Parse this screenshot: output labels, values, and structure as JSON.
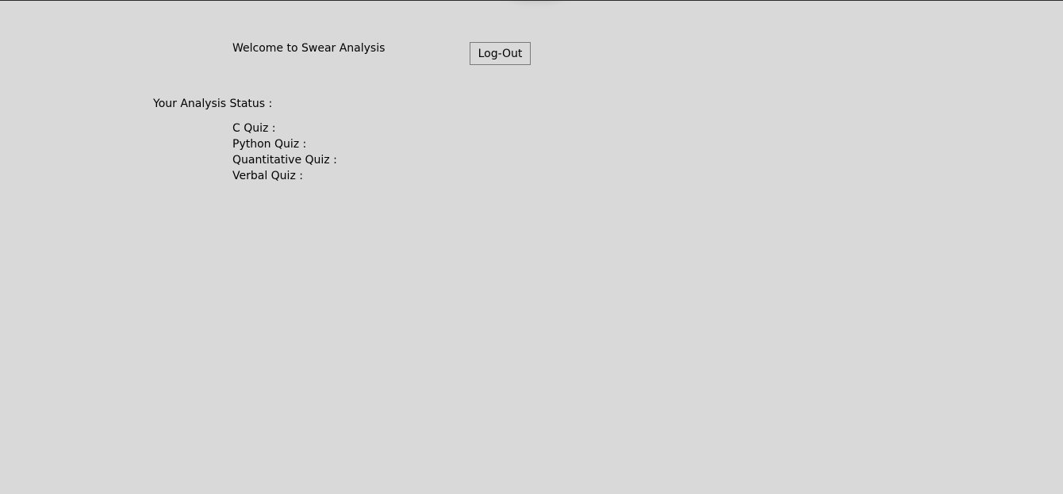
{
  "header": {
    "welcome_text": "Welcome to Swear Analysis",
    "logout_label": "Log-Out"
  },
  "status": {
    "heading": "Your Analysis Status :",
    "quizzes": [
      {
        "label": "C Quiz :"
      },
      {
        "label": "Python Quiz :"
      },
      {
        "label": "Quantitative Quiz :"
      },
      {
        "label": "Verbal Quiz :"
      }
    ]
  },
  "colors": {
    "background": "#d9d9d9",
    "text": "#000000"
  }
}
